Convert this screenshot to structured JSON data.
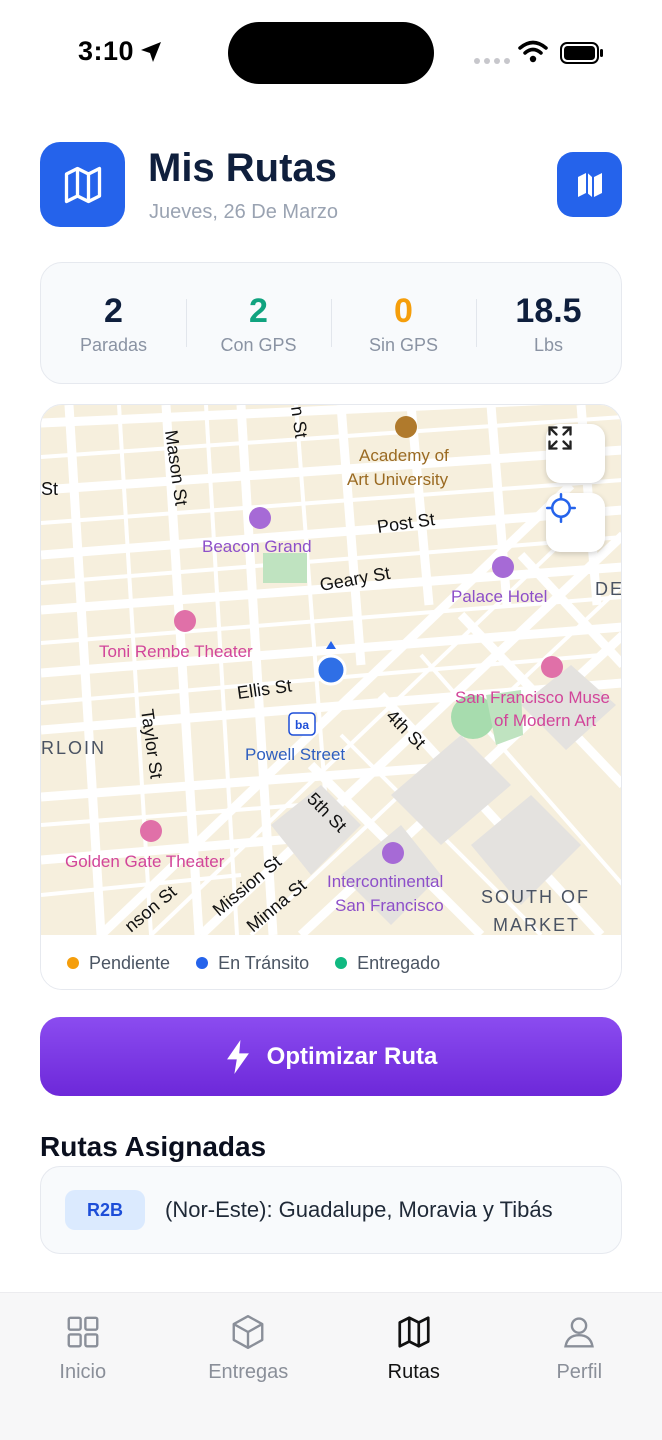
{
  "status_bar": {
    "time": "3:10"
  },
  "header": {
    "title": "Mis Rutas",
    "date": "Jueves, 26 De Marzo",
    "app_icon": "map-icon",
    "action_icon": "map-icon"
  },
  "stats": [
    {
      "value": "2",
      "label": "Paradas",
      "color": "#0f1f3d"
    },
    {
      "value": "2",
      "label": "Con GPS",
      "color": "#10a37f"
    },
    {
      "value": "0",
      "label": "Sin GPS",
      "color": "#f59e0b"
    },
    {
      "value": "18.5",
      "label": "Lbs",
      "color": "#0f1f3d"
    }
  ],
  "map": {
    "labels": {
      "academy": "Academy of",
      "academy2": "Art University",
      "beacon": "Beacon Grand",
      "post": "Post St",
      "geary": "Geary St",
      "palace": "Palace Hotel",
      "toni": "Toni Rembe Theater",
      "ellis": "Ellis St",
      "sfmoma1": "San Francisco Muse",
      "sfmoma2": "of Modern Art",
      "powell": "Powell Street",
      "fourth": "4th St",
      "taylor": "Taylor St",
      "tenderloin": "RLOIN",
      "mason": "Mason St",
      "stockton": "n St",
      "fifth": "5th St",
      "golden": "Golden Gate Theater",
      "intercont1": "Intercontinental",
      "intercont2": "San Francisco",
      "south1": "SOUTH OF",
      "south2": "MARKET",
      "mission": "Mission St",
      "minna": "Minna St",
      "jones": "nson St",
      "de": "DE",
      "st_left": "St"
    },
    "controls": [
      "expand-icon",
      "locate-icon"
    ]
  },
  "legend": [
    {
      "label": "Pendiente",
      "color": "#f59e0b"
    },
    {
      "label": "En Tránsito",
      "color": "#2563eb"
    },
    {
      "label": "Entregado",
      "color": "#10b981"
    }
  ],
  "optimize_button": {
    "label": "Optimizar Ruta",
    "icon": "bolt-icon"
  },
  "assigned": {
    "title": "Rutas Asignadas",
    "routes": [
      {
        "code": "R2B",
        "name": "(Nor-Este): Guadalupe, Moravia y Tibás"
      }
    ]
  },
  "tabs": [
    {
      "label": "Inicio",
      "icon": "grid-icon",
      "active": false
    },
    {
      "label": "Entregas",
      "icon": "box-icon",
      "active": false
    },
    {
      "label": "Rutas",
      "icon": "map-icon",
      "active": true
    },
    {
      "label": "Perfil",
      "icon": "user-icon",
      "active": false
    }
  ]
}
